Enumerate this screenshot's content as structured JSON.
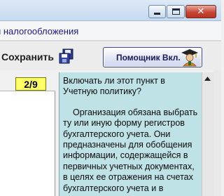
{
  "window": {
    "close_glyph": "✕"
  },
  "menu": {
    "item_label": "и налогообложения"
  },
  "toolbar": {
    "save_label": "Сохранить",
    "helper_label": "Помощник Вкл."
  },
  "counter": {
    "page": "2/9"
  },
  "help": {
    "question": "Включать ли этот пункт в Учетную политику?",
    "body": "Организация обязана выбрать ту или иную форму регистров бухгалтерского учета. Они предназначены для обобщения информации, содержащейся в первичных учетных документах, в целях ее отражения на счетах бухгалтерского учета и в"
  },
  "colors": {
    "help_background": "#bfe2e6",
    "counter_background": "#ffff66"
  }
}
